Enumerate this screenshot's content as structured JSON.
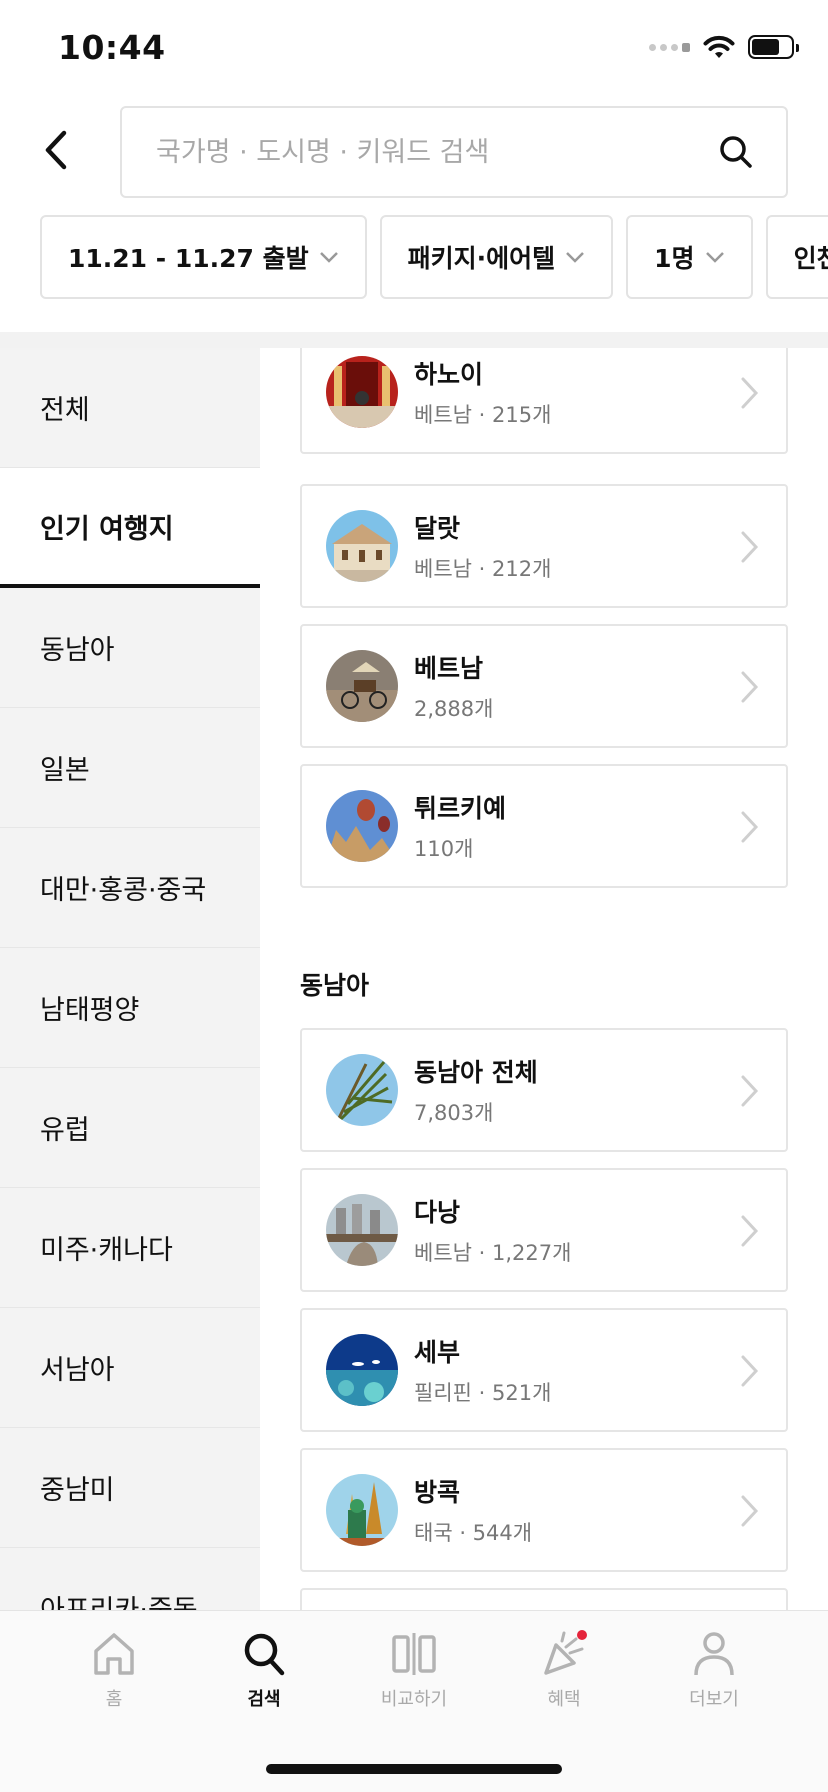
{
  "status_bar": {
    "time": "10:44"
  },
  "search": {
    "placeholder": "국가명 · 도시명 · 키워드 검색"
  },
  "filters": [
    {
      "label": "11.21 - 11.27 출발"
    },
    {
      "label": "패키지·에어텔"
    },
    {
      "label": "1명"
    },
    {
      "label": "인천·김포"
    }
  ],
  "categories": [
    {
      "label": "전체"
    },
    {
      "label": "인기 여행지",
      "active": true
    },
    {
      "label": "동남아"
    },
    {
      "label": "일본"
    },
    {
      "label": "대만·홍콩·중국"
    },
    {
      "label": "남태평양"
    },
    {
      "label": "유럽"
    },
    {
      "label": "미주·캐나다"
    },
    {
      "label": "서남아"
    },
    {
      "label": "중남미"
    },
    {
      "label": "아프리카·중동"
    }
  ],
  "popular": [
    {
      "title": "하노이",
      "sub": "베트남 · 215개",
      "icon": "hanoi-thumbnail"
    },
    {
      "title": "달랏",
      "sub": "베트남 · 212개",
      "icon": "dalat-thumbnail"
    },
    {
      "title": "베트남",
      "sub": "2,888개",
      "icon": "vietnam-thumbnail"
    },
    {
      "title": "튀르키예",
      "sub": "110개",
      "icon": "turkiye-thumbnail"
    }
  ],
  "southeast_asia": {
    "title": "동남아",
    "items": [
      {
        "title": "동남아 전체",
        "sub": "7,803개",
        "icon": "palm-thumbnail"
      },
      {
        "title": "다낭",
        "sub": "베트남 · 1,227개",
        "icon": "danang-thumbnail"
      },
      {
        "title": "세부",
        "sub": "필리핀 · 521개",
        "icon": "cebu-thumbnail"
      },
      {
        "title": "방콕",
        "sub": "태국 · 544개",
        "icon": "bangkok-thumbnail"
      }
    ]
  },
  "tabs": [
    {
      "label": "홈",
      "icon": "home-icon"
    },
    {
      "label": "검색",
      "icon": "search-icon",
      "active": true
    },
    {
      "label": "비교하기",
      "icon": "compare-icon"
    },
    {
      "label": "혜택",
      "icon": "party-icon"
    },
    {
      "label": "더보기",
      "icon": "person-icon"
    }
  ],
  "colors": {
    "accent": "#111111",
    "notification_dot": "#e5243b",
    "side_bg": "#f3f3f3"
  }
}
